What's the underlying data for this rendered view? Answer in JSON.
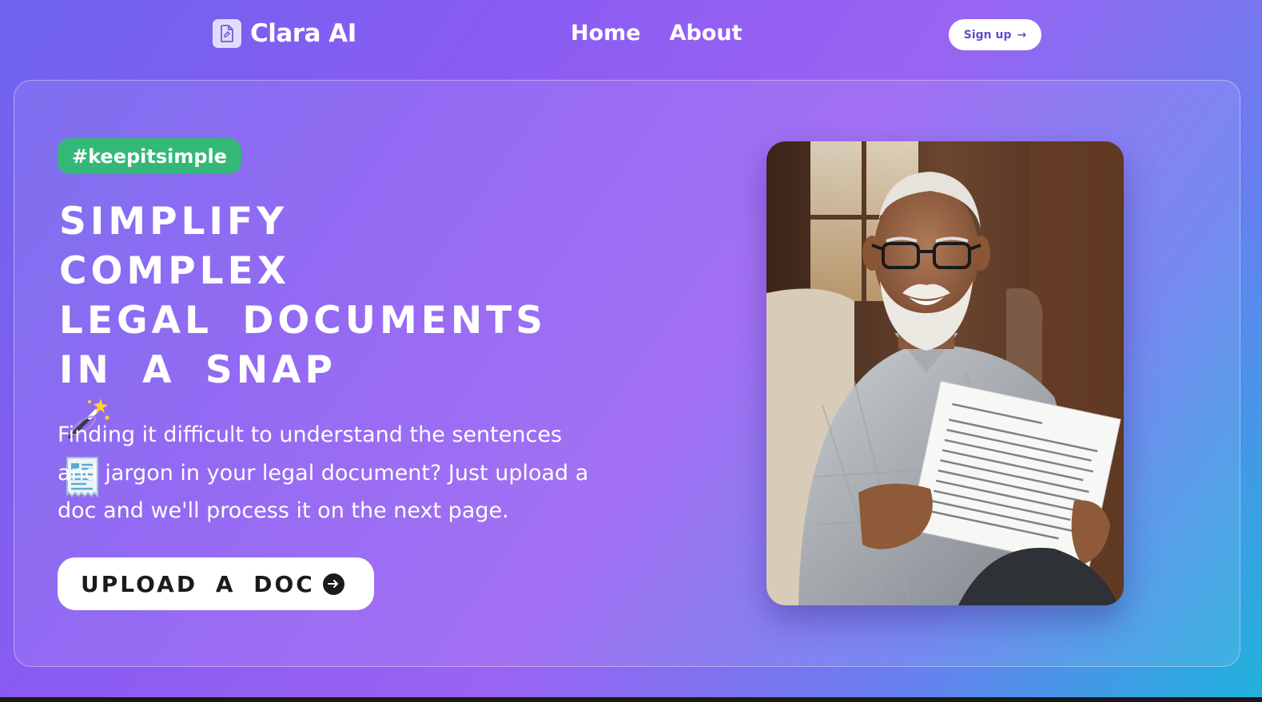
{
  "brand": {
    "name": "Clara AI",
    "icon": "document-icon"
  },
  "nav": {
    "links": [
      "Home",
      "About"
    ],
    "signup_label": "Sign up",
    "signup_arrow": "→"
  },
  "hero": {
    "tag": "#keepitsimple",
    "headline": [
      "SIMPLIFY",
      "COMPLEX",
      "LEGAL DOCUMENTS",
      "IN A SNAP"
    ],
    "headline_emojis": [
      "magic-wand-icon",
      "receipt-icon"
    ],
    "description": "Finding it difficult to understand the sentences and jargon in your legal document? Just upload a doc and we'll process it on the next page.",
    "cta_label": "UPLOAD A DOC",
    "photo_alt": "Elderly man smiling while reading a legal document"
  },
  "colors": {
    "accent_green": "#33b877",
    "gradient_start": "#6d63ee",
    "gradient_mid": "#9a63f2",
    "gradient_end": "#1fb2dc"
  }
}
